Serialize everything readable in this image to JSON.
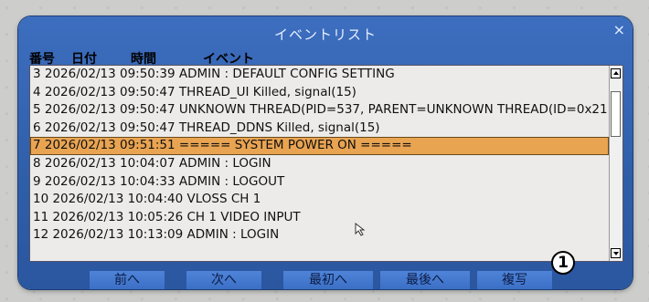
{
  "dialog": {
    "title": "イベントリスト",
    "close": "×"
  },
  "header": {
    "col_no": "番号",
    "col_date": "日付",
    "col_time": "時間",
    "col_event": "イベント"
  },
  "rows": [
    "3 2026/02/13 09:50:39 ADMIN : DEFAULT CONFIG SETTING",
    "4 2026/02/13 09:50:47 THREAD_UI Killed, signal(15)",
    "5 2026/02/13 09:50:47 UNKNOWN THREAD(PID=537, PARENT=UNKNOWN THREAD(ID=0x21",
    "6 2026/02/13 09:50:47 THREAD_DDNS Killed, signal(15)",
    "7 2026/02/13 09:51:51 ===== SYSTEM POWER ON =====",
    "8 2026/02/13 10:04:07 ADMIN : LOGIN",
    "9 2026/02/13 10:04:33 ADMIN : LOGOUT",
    "10 2026/02/13 10:04:40 VLOSS CH 1",
    "11 2026/02/13 10:05:26 CH 1 VIDEO INPUT",
    "12 2026/02/13 10:13:09 ADMIN : LOGIN"
  ],
  "selected_row_number": 7,
  "buttons": {
    "prev": "前へ",
    "next": "次へ",
    "first": "最初へ",
    "last": "最後へ",
    "copy": "複写"
  },
  "badge": "1",
  "colors": {
    "dialog": "#2f5ea9",
    "selected": "#e9a452",
    "button": "#3b70c6"
  }
}
